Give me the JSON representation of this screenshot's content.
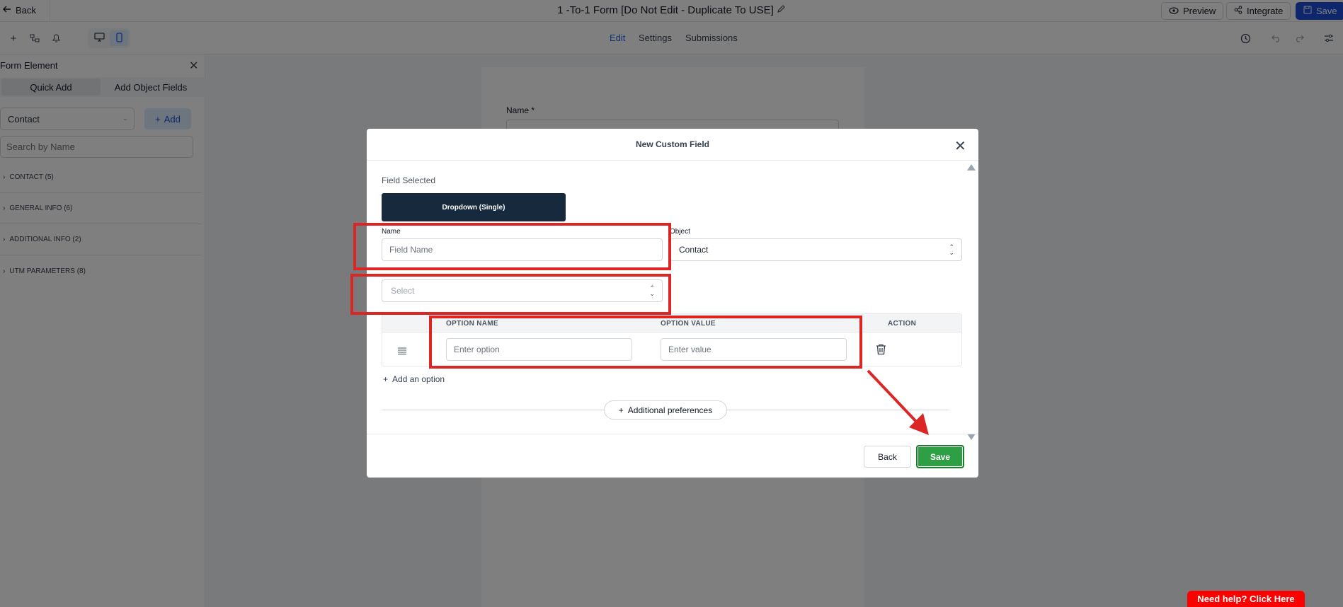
{
  "topbar": {
    "back_label": "Back",
    "form_title": "1 -To-1 Form [Do Not Edit -  Duplicate To USE]",
    "preview_label": "Preview",
    "integrate_label": "Integrate",
    "save_label": "Save"
  },
  "toolbar": {
    "tabs": [
      {
        "label": "Edit",
        "active": true
      },
      {
        "label": "Settings",
        "active": false
      },
      {
        "label": "Submissions",
        "active": false
      }
    ]
  },
  "sidebar": {
    "title": "Form Element",
    "tabs": [
      {
        "label": "Quick Add",
        "active": true
      },
      {
        "label": "Add Object Fields",
        "active": false
      }
    ],
    "object_select": "Contact",
    "add_label": "Add",
    "search_placeholder": "Search by Name",
    "groups": [
      {
        "label": "CONTACT (5)"
      },
      {
        "label": "GENERAL INFO (6)"
      },
      {
        "label": "ADDITIONAL INFO (2)"
      },
      {
        "label": "UTM PARAMETERS (8)"
      }
    ]
  },
  "canvas": {
    "name_label": "Name *"
  },
  "modal": {
    "title": "New Custom Field",
    "field_selected_label": "Field Selected",
    "field_type": "Dropdown (Single)",
    "name_label": "Name",
    "name_placeholder": "Field Name",
    "object_label": "Object",
    "object_value": "Contact",
    "group_select_placeholder": "Select",
    "table": {
      "headers": [
        "OPTION NAME",
        "OPTION VALUE",
        "ACTION"
      ],
      "option_name_placeholder": "Enter option",
      "option_value_placeholder": "Enter value"
    },
    "add_option_label": "Add an option",
    "additional_preferences_label": "Additional preferences",
    "back_label": "Back",
    "save_label": "Save"
  },
  "help_label": "Need help? Click Here",
  "colors": {
    "primary_blue": "#1d4ed8",
    "save_green": "#2ea043",
    "field_type_bg": "#17293d",
    "annotation_red": "#dc2626",
    "help_red": "#ff0000"
  }
}
